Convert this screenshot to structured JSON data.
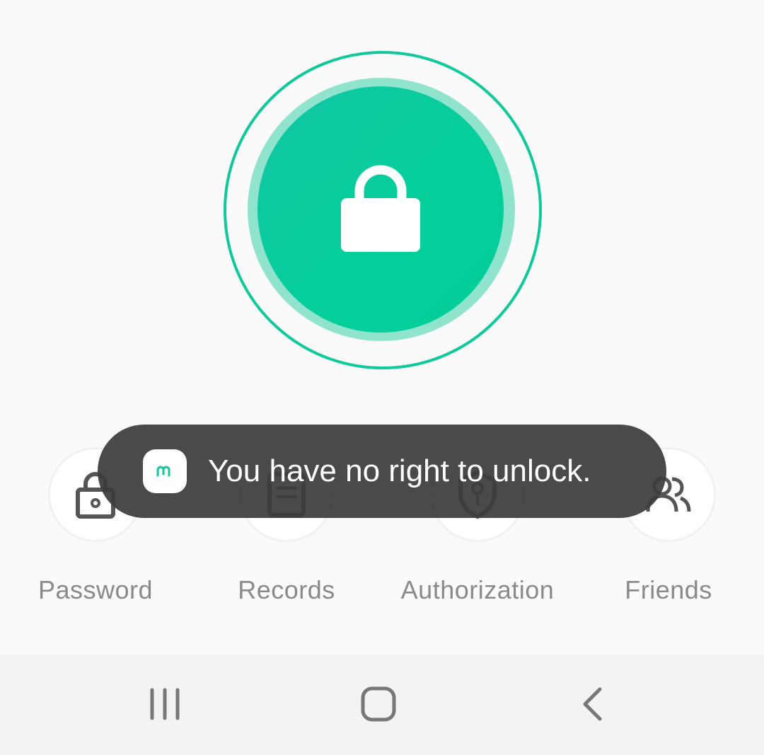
{
  "lock": {
    "icon": "padlock-icon",
    "accent_color": "#04cf9a"
  },
  "features": [
    {
      "label": "Password",
      "icon": "padlock-icon"
    },
    {
      "label": "Records",
      "icon": "document-icon"
    },
    {
      "label": "Authorization",
      "icon": "shield-key-icon"
    },
    {
      "label": "Friends",
      "icon": "people-icon"
    }
  ],
  "toast": {
    "message": "You have no right to unlock.",
    "icon": "app-logo-icon"
  },
  "navbar": {
    "recent_icon": "recent-apps-icon",
    "home_icon": "home-icon",
    "back_icon": "back-icon"
  }
}
